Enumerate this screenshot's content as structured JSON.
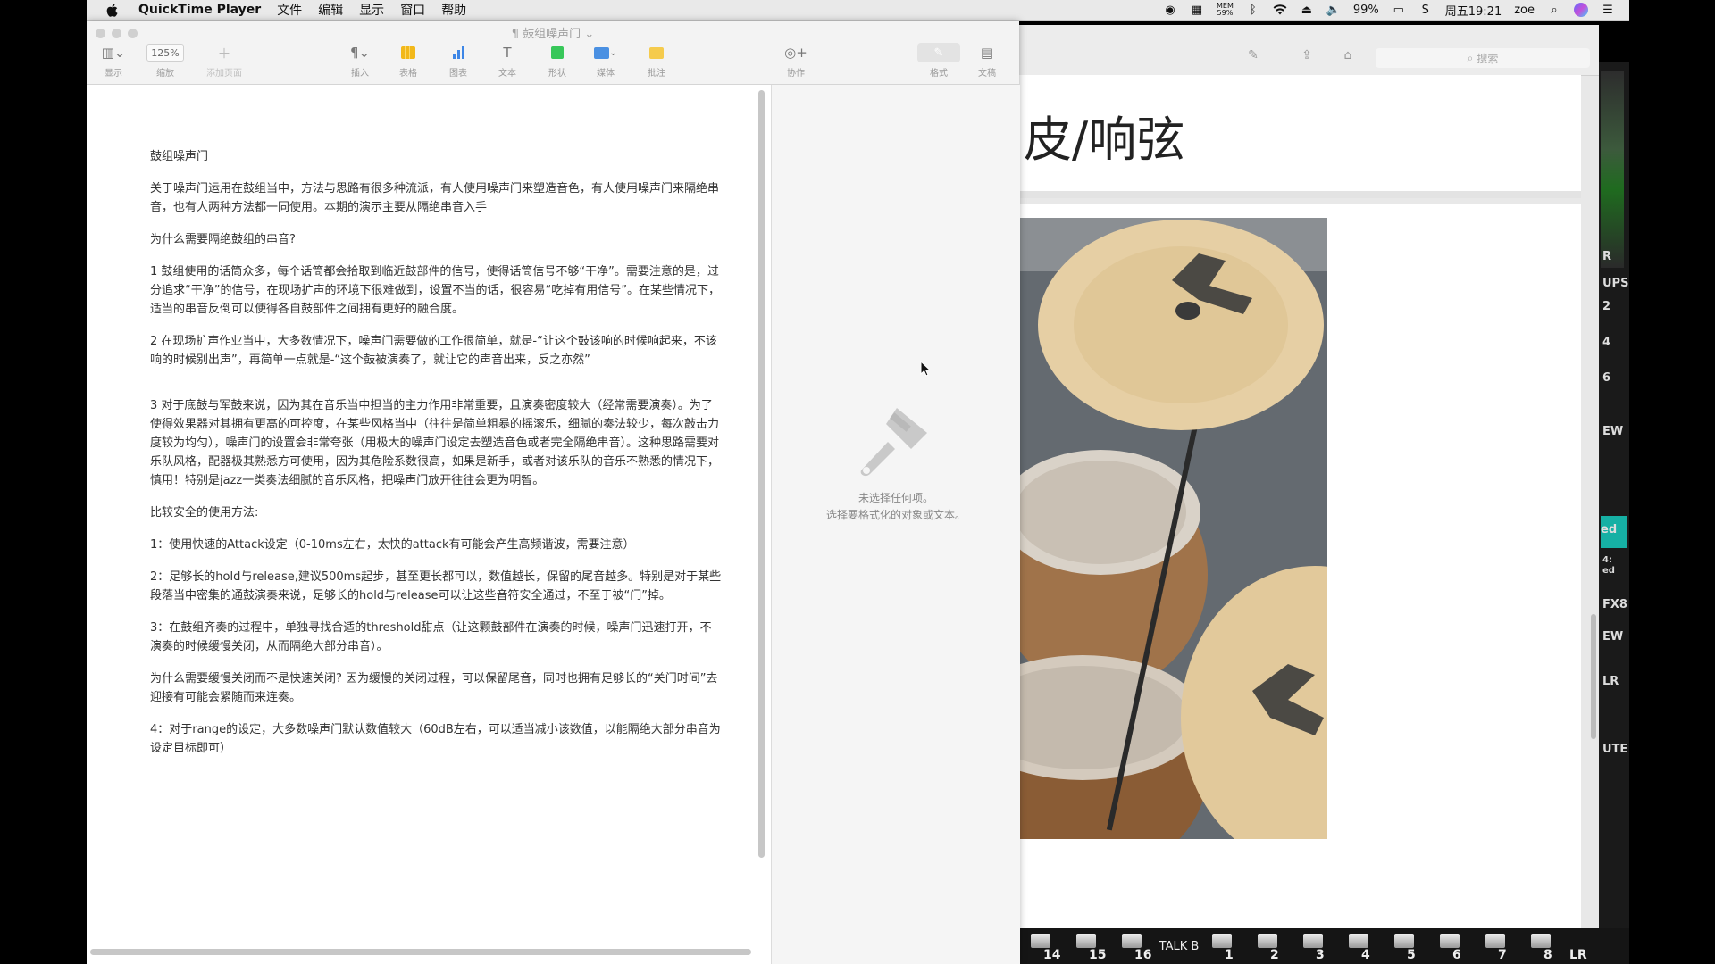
{
  "menubar": {
    "app_name": "QuickTime Player",
    "menus": [
      "文件",
      "编辑",
      "显示",
      "窗口",
      "帮助"
    ],
    "mem_label": "MEM",
    "mem_value": "59%",
    "battery": "99%",
    "datetime": "周五19:21",
    "user": "zoe"
  },
  "pages": {
    "doc_title": "鼓组噪声门",
    "toolbar": {
      "view": "显示",
      "zoom_value": "125%",
      "zoom": "缩放",
      "add_page": "添加页面",
      "insert": "插入",
      "table": "表格",
      "chart": "图表",
      "text": "文本",
      "shape": "形状",
      "media": "媒体",
      "comment": "批注",
      "collaborate": "协作",
      "format": "格式",
      "document": "文稿"
    },
    "document": {
      "title": "鼓组噪声门",
      "paragraphs": [
        "关于噪声门运用在鼓组当中，方法与思路有很多种流派，有人使用噪声门来塑造音色，有人使用噪声门来隔绝串音，也有人两种方法都一同使用。本期的演示主要从隔绝串音入手",
        "为什么需要隔绝鼓组的串音?",
        "1 鼓组使用的话筒众多，每个话筒都会拾取到临近鼓部件的信号，使得话筒信号不够“干净”。需要注意的是，过分追求“干净”的信号，在现场扩声的环境下很难做到，设置不当的话，很容易“吃掉有用信号”。在某些情况下，适当的串音反倒可以使得各自鼓部件之间拥有更好的融合度。",
        "2 在现场扩声作业当中，大多数情况下，噪声门需要做的工作很简单，就是-“让这个鼓该响的时候响起来，不该响的时候别出声”，再简单一点就是-“这个鼓被演奏了，就让它的声音出来，反之亦然”",
        "3 对于底鼓与军鼓来说，因为其在音乐当中担当的主力作用非常重要，且演奏密度较大（经常需要演奏）。为了使得效果器对其拥有更高的可控度，在某些风格当中（往往是简单粗暴的摇滚乐，细腻的奏法较少，每次敲击力度较为均匀），噪声门的设置会非常夸张（用极大的噪声门设定去塑造音色或者完全隔绝串音）。这种思路需要对乐队风格，配器极其熟悉方可使用，因为其危险系数很高，如果是新手，或者对该乐队的音乐不熟悉的情况下，慎用！特别是jazz一类奏法细腻的音乐风格，把噪声门放开往往会更为明智。",
        "比较安全的使用方法:",
        "1：使用快速的Attack设定（0-10ms左右，太快的attack有可能会产生高频谐波，需要注意）",
        "2：足够长的hold与release,建议500ms起步，甚至更长都可以，数值越长，保留的尾音越多。特别是对于某些段落当中密集的通鼓演奏来说，足够长的hold与release可以让这些音符安全通过，不至于被“门”掉。",
        "3：在鼓组齐奏的过程中，单独寻找合适的threshold甜点（让这颗鼓部件在演奏的时候，噪声门迅速打开，不演奏的时候缓慢关闭，从而隔绝大部分串音）。",
        "为什么需要缓慢关闭而不是快速关闭? 因为缓慢的关闭过程，可以保留尾音，同时也拥有足够长的“关门时间”去迎接有可能会紧随而来连奏。",
        "4：对于range的设定，大多数噪声门默认数值较大（60dB左右，可以适当减小该数值，以能隔绝大部分串音为设定目标即可）"
      ]
    },
    "inspector": {
      "line1": "未选择任何项。",
      "line2": "选择要格式化的对象或文本。"
    }
  },
  "browser": {
    "search_placeholder": "搜索",
    "heading": "皮/响弦"
  },
  "mixer": {
    "right_labels": [
      "R",
      "UPS",
      "2",
      "4",
      "6",
      "EW",
      "ed",
      "4:",
      "ed",
      "FX8",
      "EW",
      "LR",
      "UTE"
    ],
    "bottom_channels": [
      "14",
      "15",
      "16",
      "1",
      "2",
      "3",
      "4",
      "5",
      "6",
      "7",
      "8"
    ],
    "talkback": "TALK B",
    "lr": "LR"
  }
}
